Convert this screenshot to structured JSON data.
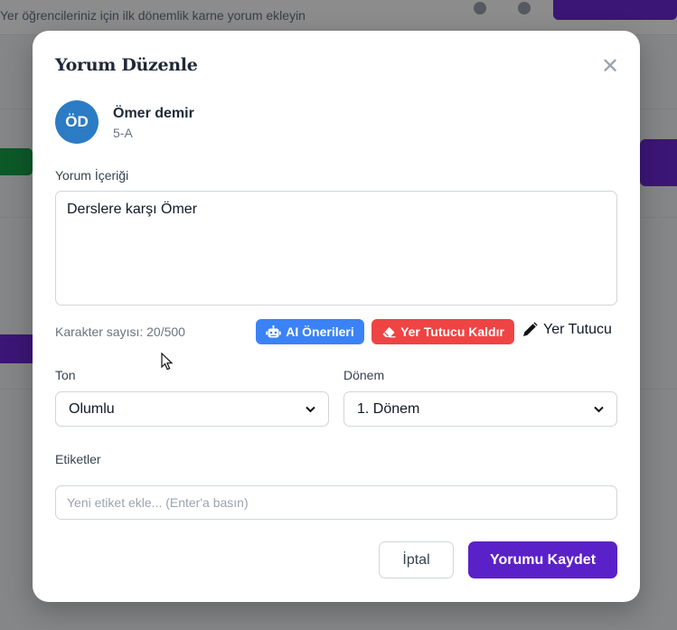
{
  "background": {
    "subtitle": "Yer öğrencileriniz için ilk dönemlik karne yorum ekleyin"
  },
  "modal": {
    "title": "Yorum Düzenle",
    "close_symbol": "✕",
    "student": {
      "initials": "ÖD",
      "name": "Ömer demir",
      "class": "5-A"
    },
    "comment": {
      "label": "Yorum İçeriği",
      "value": "Derslere karşı Ömer",
      "char_count": "Karakter sayısı: 20/500"
    },
    "actions": {
      "ai_label": "AI Önerileri",
      "remove_placeholder_label": "Yer Tutucu Kaldır",
      "placeholder_label": "Yer Tutucu"
    },
    "tone": {
      "label": "Ton",
      "value": "Olumlu"
    },
    "term": {
      "label": "Dönem",
      "value": "1. Dönem"
    },
    "tags": {
      "label": "Etiketler",
      "placeholder": "Yeni etiket ekle... (Enter'a basın)"
    },
    "footer": {
      "cancel_label": "İptal",
      "save_label": "Yorumu Kaydet"
    }
  },
  "colors": {
    "primary": "#5b21c8",
    "ai_button": "#3b82f6",
    "danger": "#ef4444",
    "avatar": "#2b7cc4"
  }
}
